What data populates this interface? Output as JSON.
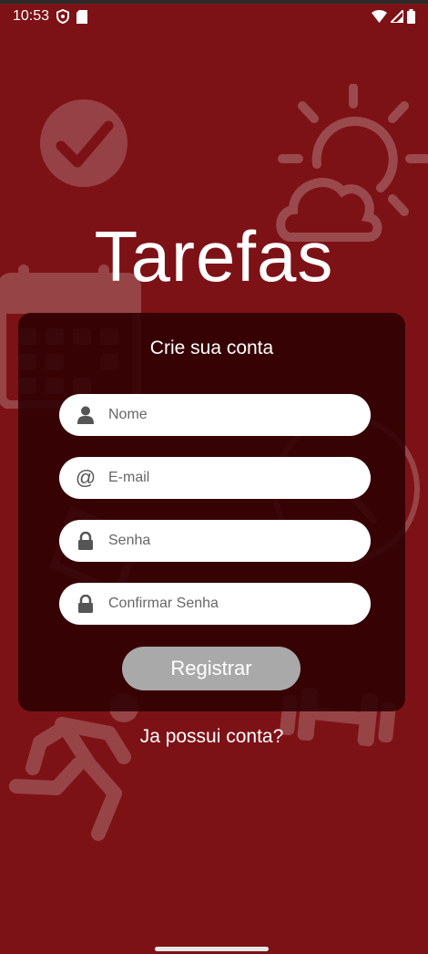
{
  "status_bar": {
    "time": "10:53",
    "icons_left": [
      "shield-icon",
      "sd-card-icon"
    ],
    "icons_right": [
      "wifi-icon",
      "signal-icon",
      "battery-icon"
    ]
  },
  "app": {
    "title": "Tarefas"
  },
  "form": {
    "heading": "Crie sua conta",
    "fields": [
      {
        "icon": "person-icon",
        "placeholder": "Nome",
        "value": ""
      },
      {
        "icon": "at-icon",
        "placeholder": "E-mail",
        "value": ""
      },
      {
        "icon": "lock-icon",
        "placeholder": "Senha",
        "value": ""
      },
      {
        "icon": "lock-icon",
        "placeholder": "Confirmar Senha",
        "value": ""
      }
    ],
    "register_label": "Registrar",
    "at_symbol": "@"
  },
  "login_link": "Ja possui conta?",
  "colors": {
    "background": "#7d1216",
    "card": "#2d0002",
    "button_disabled": "#a9a9a9",
    "field": "#ffffff"
  }
}
